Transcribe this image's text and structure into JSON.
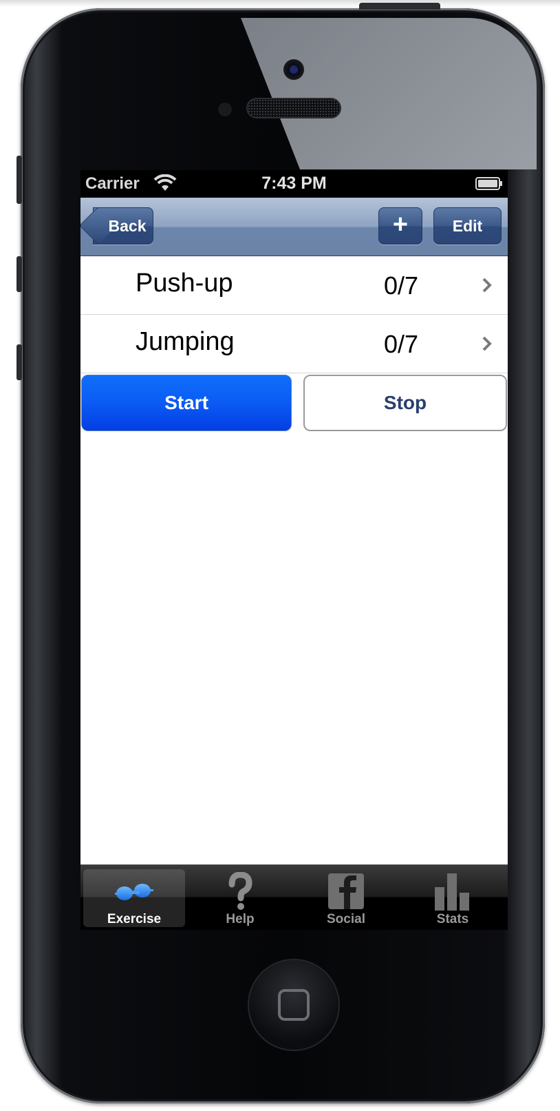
{
  "status": {
    "carrier": "Carrier",
    "time": "7:43 PM"
  },
  "nav": {
    "back_label": "Back",
    "add_label": "+",
    "edit_label": "Edit"
  },
  "exercises": [
    {
      "name": "Push-up",
      "count": "0/7"
    },
    {
      "name": "Jumping",
      "count": "0/7"
    }
  ],
  "controls": {
    "start_label": "Start",
    "stop_label": "Stop"
  },
  "tabs": [
    {
      "label": "Exercise",
      "icon": "dumbbell-icon",
      "active": true
    },
    {
      "label": "Help",
      "icon": "question-icon",
      "active": false
    },
    {
      "label": "Social",
      "icon": "facebook-icon",
      "active": false
    },
    {
      "label": "Stats",
      "icon": "bar-chart-icon",
      "active": false
    }
  ],
  "colors": {
    "nav_bar": "#6b83a7",
    "start_button": "#0b5bf4",
    "stop_text": "#2a3f6e",
    "tab_bar": "#000000"
  }
}
